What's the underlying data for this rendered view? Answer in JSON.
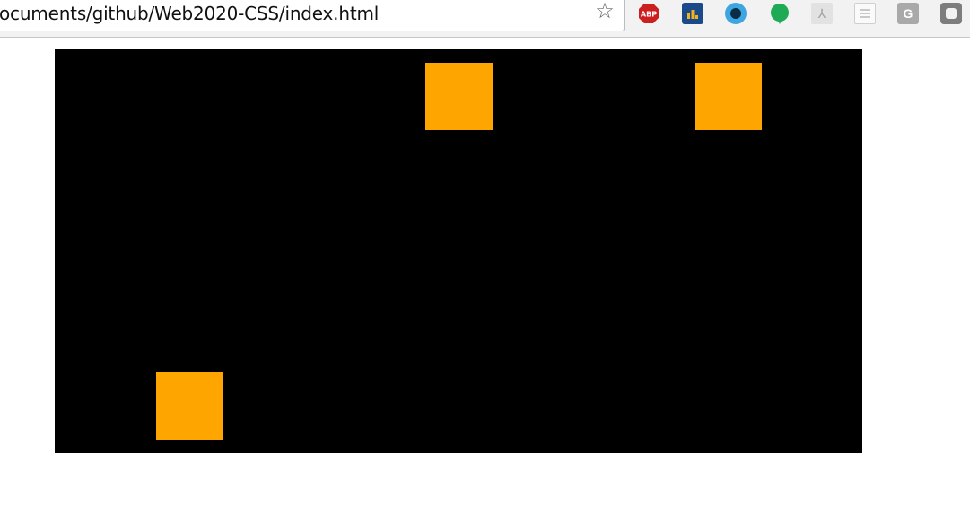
{
  "browser": {
    "url": "ocuments/github/Web2020-CSS/index.html",
    "bookmark_icon": "star-icon",
    "extensions": [
      {
        "name": "abp-icon",
        "label": "ABP"
      },
      {
        "name": "bar-chart-extension-icon"
      },
      {
        "name": "eye-extension-icon"
      },
      {
        "name": "chat-bubble-extension-icon"
      },
      {
        "name": "pdf-extension-icon"
      },
      {
        "name": "document-extension-icon"
      },
      {
        "name": "g-extension-icon",
        "label": "G"
      },
      {
        "name": "square-extension-icon"
      }
    ]
  },
  "page": {
    "stage_color": "#000000",
    "box_color": "#ffa500",
    "box_count": 3
  }
}
